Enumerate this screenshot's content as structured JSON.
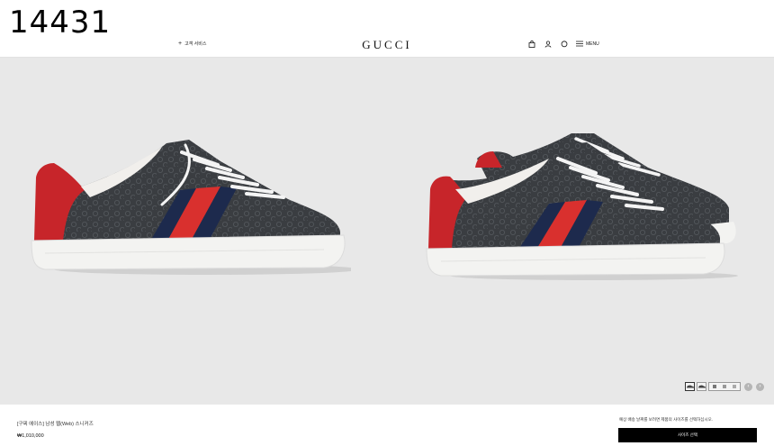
{
  "watermark": "14431",
  "header": {
    "service_label": "고객 서비스",
    "logo": "GUCCI",
    "menu_label": "MENU",
    "icons": [
      "shopping-bag-icon",
      "user-icon",
      "chat-icon",
      "hamburger-icon"
    ]
  },
  "gallery": {
    "thumbnail_count": 5,
    "active_thumbnail": 1,
    "prev_arrow": "‹",
    "next_arrow": "›"
  },
  "product": {
    "name": "[구찌 에이스] 남성 웹(Web) 스니커즈",
    "price": "₩1,010,000"
  },
  "purchase": {
    "delivery_note": "예상 배송 날짜를 보려면 제품의 사이즈를 선택하십시오.",
    "size_button_label": "사이즈 선택"
  },
  "colors": {
    "background": "#e8e8e8",
    "canvas": "#3a3d41",
    "web_red": "#d9302e",
    "web_navy": "#1d2a4d",
    "heel_red": "#c7252a",
    "sole": "#f3f3f1",
    "button": "#000000"
  }
}
